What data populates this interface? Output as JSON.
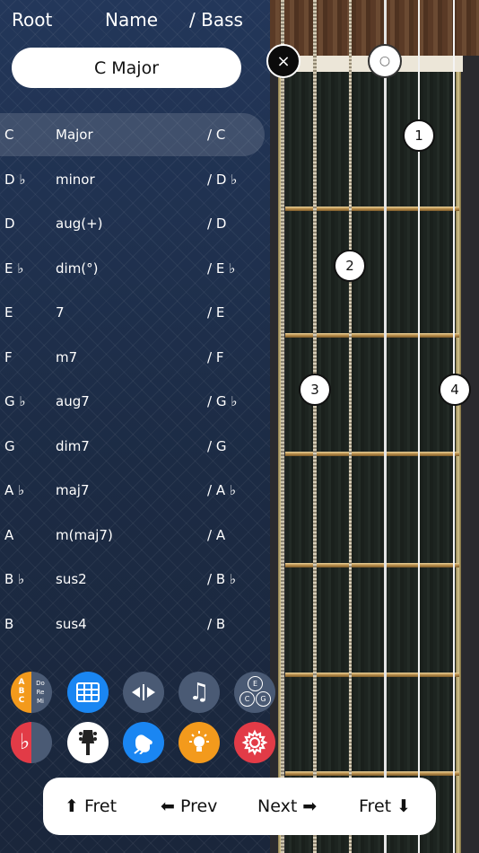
{
  "header": {
    "root": "Root",
    "name": "Name",
    "bass": "/ Bass"
  },
  "current_chord": "C Major",
  "rows": [
    {
      "root": "C",
      "name": "Major",
      "bass": "/ C"
    },
    {
      "root": "D ♭",
      "name": "minor",
      "bass": "/ D ♭"
    },
    {
      "root": "D",
      "name": "aug(+)",
      "bass": "/ D"
    },
    {
      "root": "E ♭",
      "name": "dim(°)",
      "bass": "/ E ♭"
    },
    {
      "root": "E",
      "name": "7",
      "bass": "/ E"
    },
    {
      "root": "F",
      "name": "m7",
      "bass": "/ F"
    },
    {
      "root": "G ♭",
      "name": "aug7",
      "bass": "/ G ♭"
    },
    {
      "root": "G",
      "name": "dim7",
      "bass": "/ G"
    },
    {
      "root": "A ♭",
      "name": "maj7",
      "bass": "/ A ♭"
    },
    {
      "root": "A",
      "name": "m(maj7)",
      "bass": "/ A"
    },
    {
      "root": "B ♭",
      "name": "sus2",
      "bass": "/ B ♭"
    },
    {
      "root": "B",
      "name": "sus4",
      "bass": "/ B"
    }
  ],
  "fingerboard": {
    "muted_symbol": "×",
    "open_symbol": "○",
    "finger_1": "1",
    "finger_2": "2",
    "finger_3": "3",
    "finger_4": "4"
  },
  "toolbar": {
    "notation_letters": [
      "A",
      "B",
      "C"
    ],
    "notation_solfege": [
      "Do",
      "Re",
      "Mi"
    ],
    "flat_symbol": "♭",
    "music_note": "♫",
    "triad_notes": [
      "E",
      "C",
      "G"
    ]
  },
  "nav": {
    "fret_up": "⬆ Fret",
    "prev": "⬅ Prev",
    "next": "Next ➡",
    "fret_down": "Fret ⬇"
  },
  "colors": {
    "accent_blue": "#1a86f2",
    "orange": "#f39a1c",
    "red": "#e23b47"
  }
}
